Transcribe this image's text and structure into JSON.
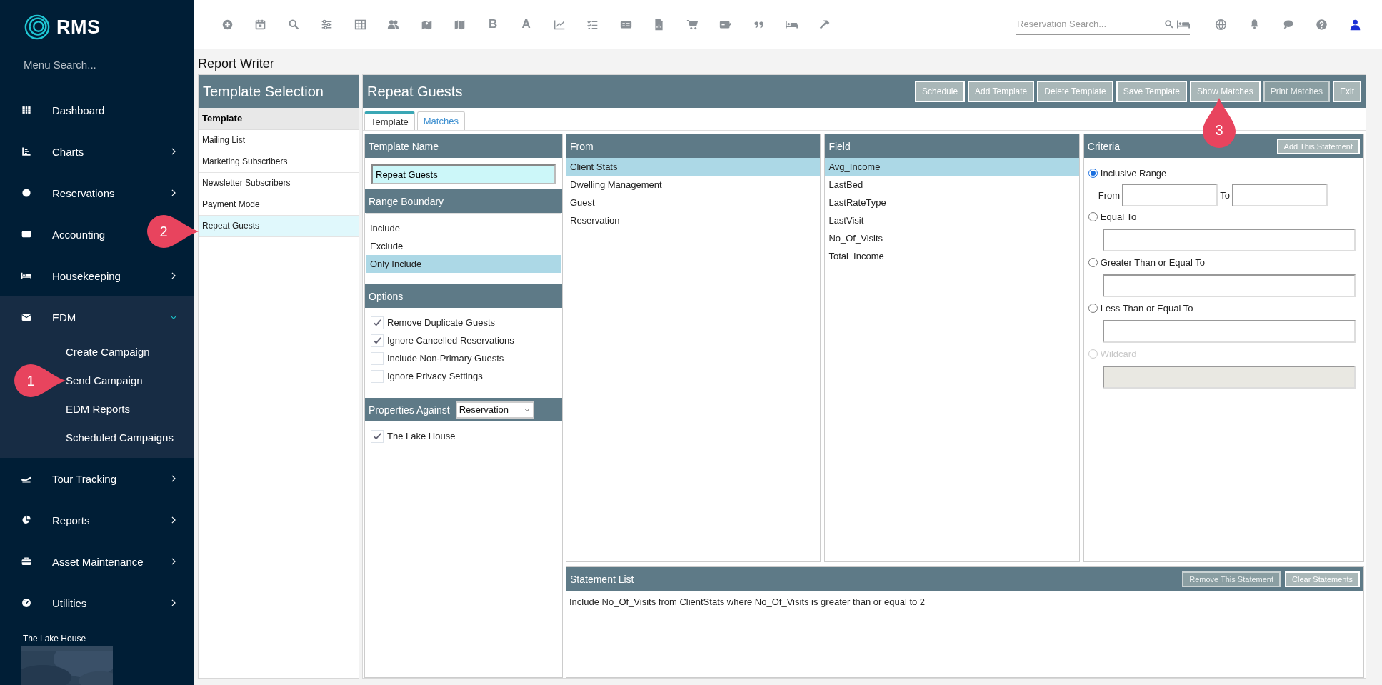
{
  "sidebar": {
    "logo": "RMS",
    "menu_search": {
      "placeholder": "Menu Search..."
    },
    "items": [
      {
        "label": "Dashboard",
        "expandable": false,
        "expanded": false
      },
      {
        "label": "Charts",
        "expandable": true,
        "expanded": false
      },
      {
        "label": "Reservations",
        "expandable": true,
        "expanded": false
      },
      {
        "label": "Accounting",
        "expandable": false,
        "expanded": false
      },
      {
        "label": "Housekeeping",
        "expandable": true,
        "expanded": false
      },
      {
        "label": "EDM",
        "expandable": true,
        "expanded": true,
        "children": [
          {
            "label": "Create Campaign"
          },
          {
            "label": "Send Campaign"
          },
          {
            "label": "EDM Reports"
          },
          {
            "label": "Scheduled Campaigns"
          }
        ]
      },
      {
        "label": "Tour Tracking",
        "expandable": true,
        "expanded": false
      },
      {
        "label": "Reports",
        "expandable": true,
        "expanded": false
      },
      {
        "label": "Asset Maintenance",
        "expandable": true,
        "expanded": false
      },
      {
        "label": "Utilities",
        "expandable": true,
        "expanded": false
      }
    ],
    "property": "The Lake House"
  },
  "toolbar": {
    "letters": [
      "B",
      "A"
    ]
  },
  "search": {
    "placeholder": "Reservation Search..."
  },
  "page_title": "Report Writer",
  "template_selection": {
    "title": "Template Selection",
    "header": "Template",
    "items": [
      {
        "label": "Mailing List",
        "selected": false
      },
      {
        "label": "Marketing Subscribers",
        "selected": false
      },
      {
        "label": "Newsletter Subscribers",
        "selected": false
      },
      {
        "label": "Payment Mode",
        "selected": false
      },
      {
        "label": "Repeat Guests",
        "selected": true
      }
    ]
  },
  "report": {
    "title": "Repeat Guests",
    "buttons": [
      {
        "label": "Schedule",
        "disabled": false
      },
      {
        "label": "Add Template",
        "disabled": false
      },
      {
        "label": "Delete Template",
        "disabled": false
      },
      {
        "label": "Save Template",
        "disabled": false
      },
      {
        "label": "Show Matches",
        "disabled": false
      },
      {
        "label": "Print Matches",
        "disabled": true
      },
      {
        "label": "Exit",
        "disabled": false
      }
    ],
    "tabs": [
      {
        "label": "Template",
        "selected": true
      },
      {
        "label": "Matches",
        "selected": false
      }
    ],
    "template_name": {
      "title": "Template Name",
      "value": "Repeat Guests"
    },
    "range_boundary": {
      "title": "Range Boundary",
      "options": [
        {
          "label": "Include",
          "selected": false
        },
        {
          "label": "Exclude",
          "selected": false
        },
        {
          "label": "Only Include",
          "selected": true
        }
      ]
    },
    "options": {
      "title": "Options",
      "items": [
        {
          "label": "Remove Duplicate Guests",
          "checked": true
        },
        {
          "label": "Ignore Cancelled Reservations",
          "checked": true
        },
        {
          "label": "Include Non-Primary Guests",
          "checked": false
        },
        {
          "label": "Ignore Privacy Settings",
          "checked": false
        }
      ]
    },
    "properties": {
      "title": "Properties Against",
      "value": "Reservation",
      "items": [
        {
          "label": "The Lake House",
          "checked": true
        }
      ]
    },
    "from": {
      "title": "From",
      "items": [
        {
          "label": "Client Stats",
          "selected": true
        },
        {
          "label": "Dwelling Management",
          "selected": false
        },
        {
          "label": "Guest",
          "selected": false
        },
        {
          "label": "Reservation",
          "selected": false
        }
      ]
    },
    "field": {
      "title": "Field",
      "items": [
        {
          "label": "Avg_Income",
          "selected": true
        },
        {
          "label": "LastBed",
          "selected": false
        },
        {
          "label": "LastRateType",
          "selected": false
        },
        {
          "label": "LastVisit",
          "selected": false
        },
        {
          "label": "No_Of_Visits",
          "selected": false
        },
        {
          "label": "Total_Income",
          "selected": false
        }
      ]
    },
    "criteria": {
      "title": "Criteria",
      "button": "Add This Statement",
      "options": [
        {
          "label": "Inclusive Range",
          "kind": "range",
          "selected": true,
          "disabled": false,
          "from_label": "From",
          "to_label": "To"
        },
        {
          "label": "Equal To",
          "kind": "single",
          "selected": false,
          "disabled": false
        },
        {
          "label": "Greater Than or Equal To",
          "kind": "single",
          "selected": false,
          "disabled": false
        },
        {
          "label": "Less Than or Equal To",
          "kind": "single",
          "selected": false,
          "disabled": false
        },
        {
          "label": "Wildcard",
          "kind": "single",
          "selected": false,
          "disabled": true
        }
      ]
    },
    "statement_list": {
      "title": "Statement List",
      "buttons": [
        {
          "label": "Remove This Statement",
          "disabled": true
        },
        {
          "label": "Clear Statements",
          "disabled": false
        }
      ],
      "statements": [
        "Include No_Of_Visits from ClientStats where No_Of_Visits is greater than or equal to 2"
      ]
    }
  },
  "callouts": [
    {
      "label": "1"
    },
    {
      "label": "2"
    },
    {
      "label": "3"
    }
  ]
}
